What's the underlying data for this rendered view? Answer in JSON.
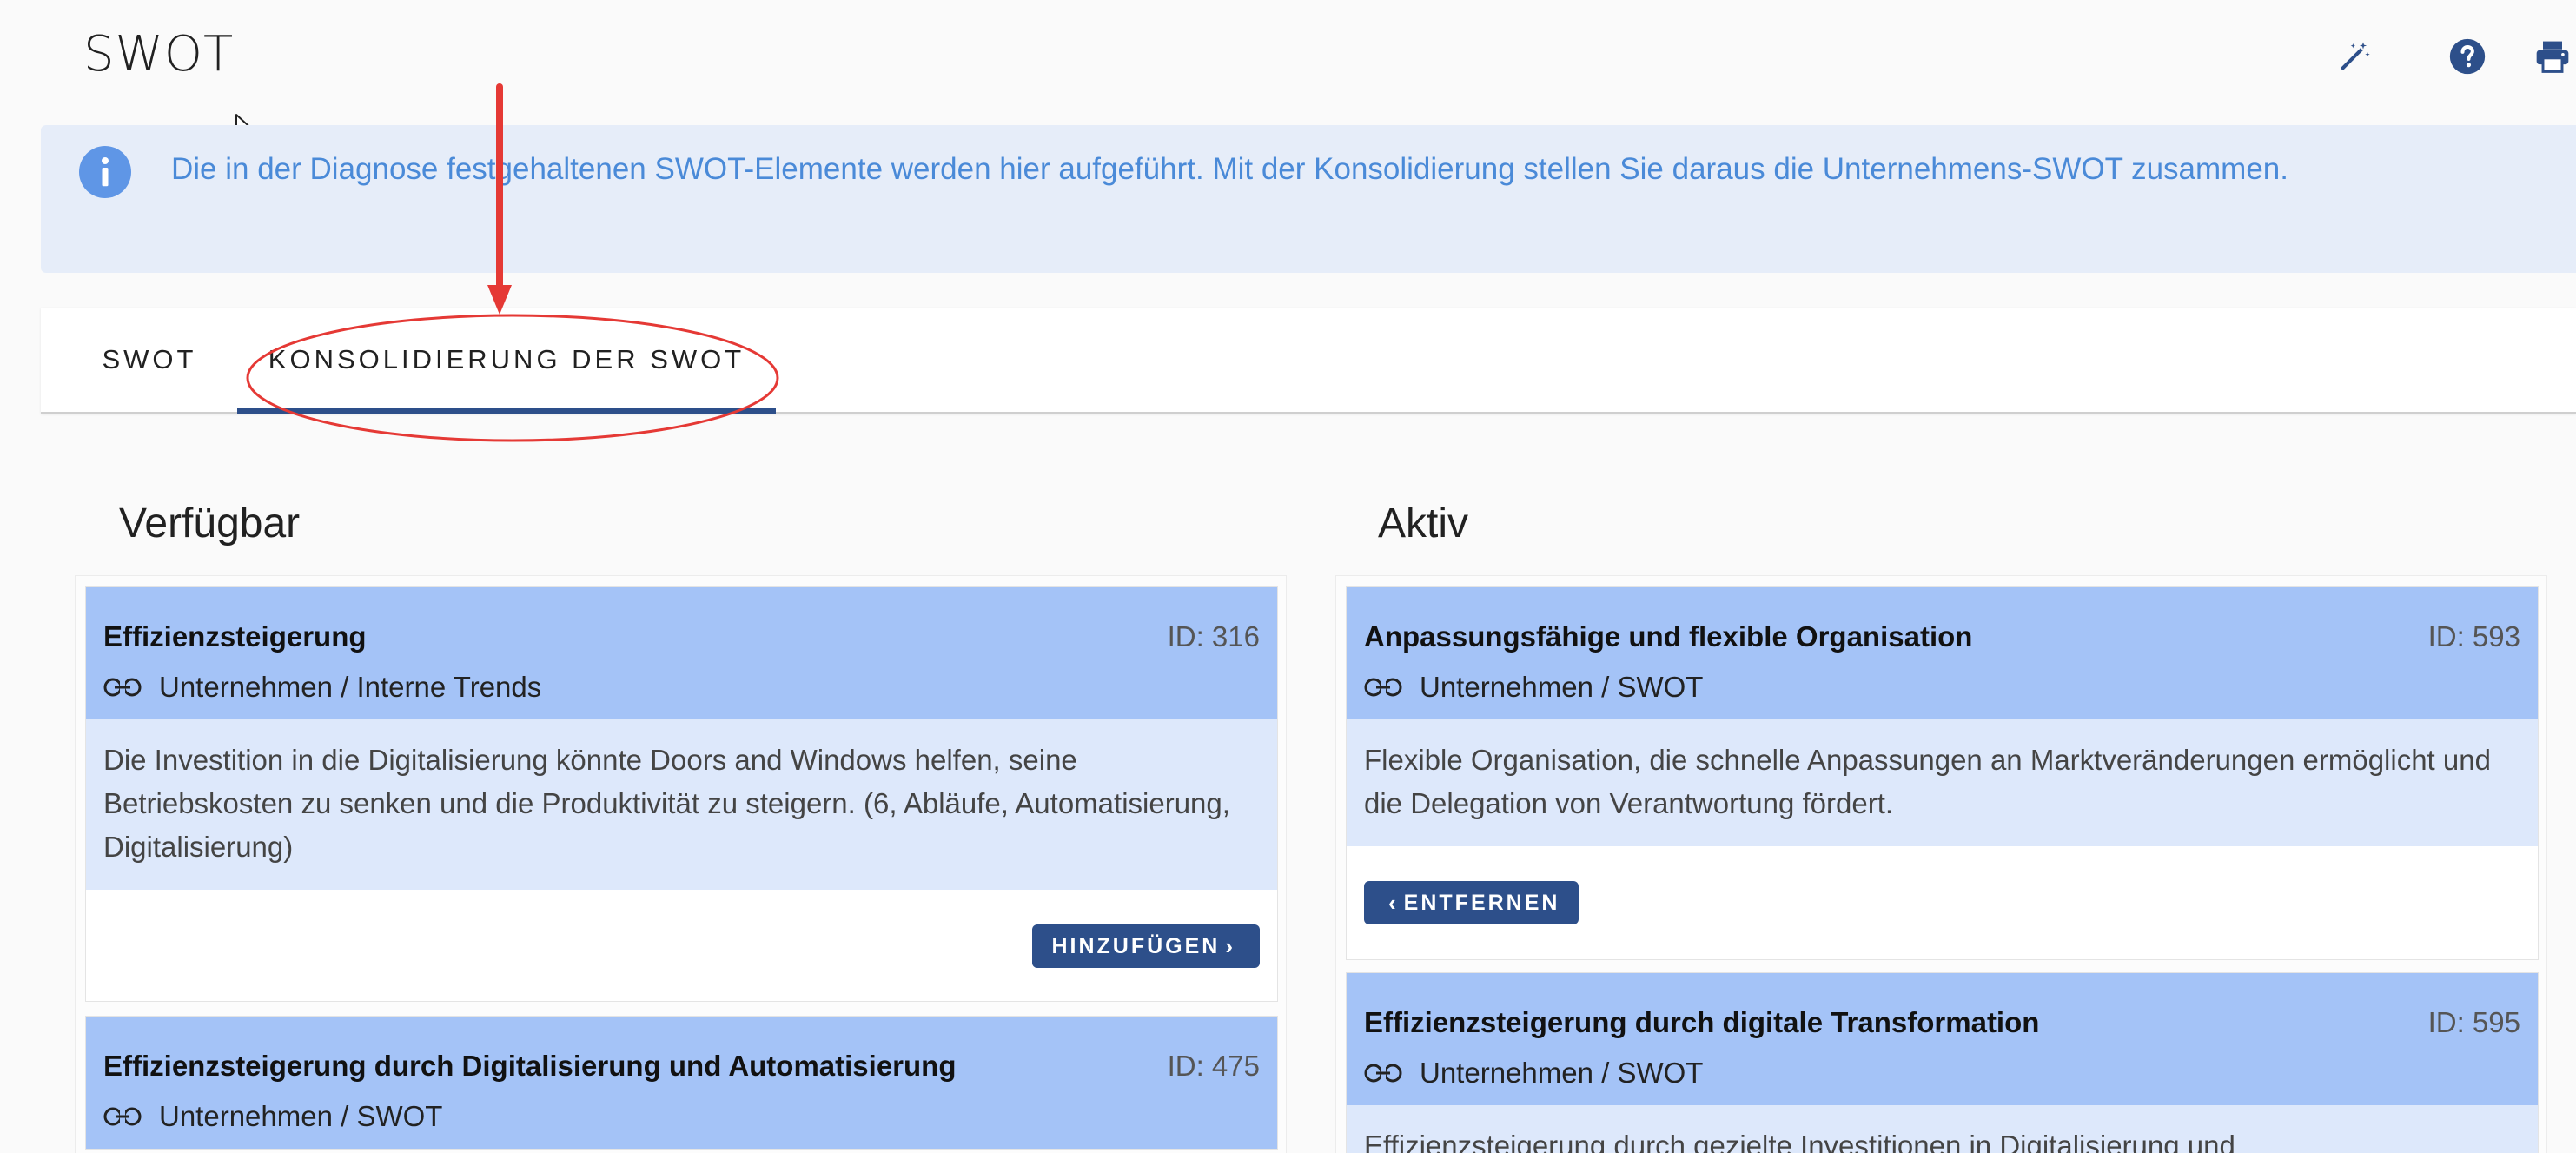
{
  "page": {
    "title": "SWOT"
  },
  "toolbar": {
    "icons": [
      "magic-wand-icon",
      "help-icon",
      "print-icon"
    ]
  },
  "banner": {
    "text": "Die in der Diagnose festgehaltenen SWOT-Elemente werden hier aufgeführt. Mit der Konsolidierung stellen Sie daraus die Unternehmens-SWOT zusammen."
  },
  "tabs": [
    {
      "label": "SWOT",
      "active": false
    },
    {
      "label": "KONSOLIDIERUNG DER SWOT",
      "active": true
    }
  ],
  "annotation": {
    "color": "#e53935"
  },
  "columns": {
    "available": {
      "heading": "Verfügbar",
      "button_label": "HINZUFÜGEN",
      "cards": [
        {
          "title": "Effizienzsteigerung",
          "id": "ID: 316",
          "link": "Unternehmen / Interne Trends",
          "description": "Die Investition in die Digitalisierung könnte Doors and Windows helfen, seine Betriebskosten zu senken und die Produktivität zu steigern. (6, Abläufe, Automatisierung, Digitalisierung)"
        },
        {
          "title": "Effizienzsteigerung durch Digitalisierung und Automatisierung",
          "id": "ID: 475",
          "link": "Unternehmen / SWOT"
        }
      ]
    },
    "active": {
      "heading": "Aktiv",
      "button_label": "ENTFERNEN",
      "cards": [
        {
          "title": "Anpassungsfähige und flexible Organisation",
          "id": "ID: 593",
          "link": "Unternehmen / SWOT",
          "description": "Flexible Organisation, die schnelle Anpassungen an Marktveränderungen ermöglicht und die Delegation von Verantwortung fördert."
        },
        {
          "title": "Effizienzsteigerung durch digitale Transformation",
          "id": "ID: 595",
          "link": "Unternehmen / SWOT",
          "description": "Effizienzsteigerung durch gezielte Investitionen in Digitalisierung und"
        }
      ]
    }
  },
  "colors": {
    "accent": "#2d4f8a",
    "card_header": "#a4c3f7",
    "card_body": "#dde8fb",
    "banner_bg": "#e6edf9",
    "banner_text": "#4a8ad8"
  }
}
